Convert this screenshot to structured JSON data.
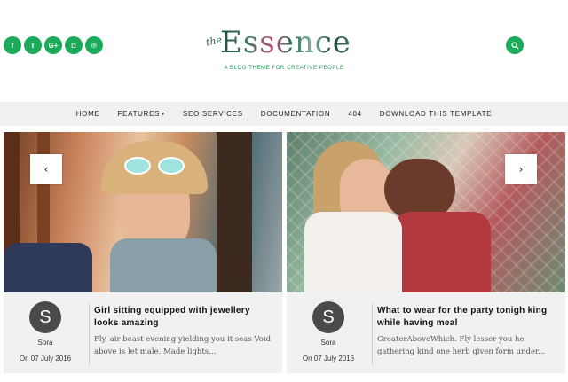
{
  "header": {
    "social": [
      {
        "icon": "facebook-icon",
        "glyph": "f"
      },
      {
        "icon": "twitter-icon",
        "glyph": "t"
      },
      {
        "icon": "google-plus-icon",
        "glyph": "G+"
      },
      {
        "icon": "instagram-icon",
        "glyph": "◘"
      },
      {
        "icon": "pinterest-icon",
        "glyph": "℗"
      }
    ],
    "logo_the": "the",
    "logo_word": "Essence",
    "tagline": "A BLOG THEME FOR CREATIVE PEOPLE",
    "search_icon": "search-icon",
    "accent_color": "#1aaa5a"
  },
  "nav": {
    "items": [
      "HOME",
      "FEATURES",
      "SEO SERVICES",
      "DOCUMENTATION",
      "404",
      "DOWNLOAD THIS TEMPLATE"
    ],
    "features_caret": "▾"
  },
  "slider": {
    "prev_glyph": "‹",
    "next_glyph": "›",
    "posts": [
      {
        "avatar_letter": "S",
        "author": "Sora",
        "date": "On 07 July 2016",
        "title": "Girl sitting equipped with jewellery looks amazing",
        "excerpt": "Fly, air beast evening yielding you it seas Void above is let male. Made lights..."
      },
      {
        "avatar_letter": "S",
        "author": "Sora",
        "date": "On 07 July 2016",
        "title": "What to wear for the party tonigh king while having meal",
        "excerpt": "GreaterAboveWhich. Fly lesser you he gathering kind one herb given form under..."
      }
    ]
  }
}
